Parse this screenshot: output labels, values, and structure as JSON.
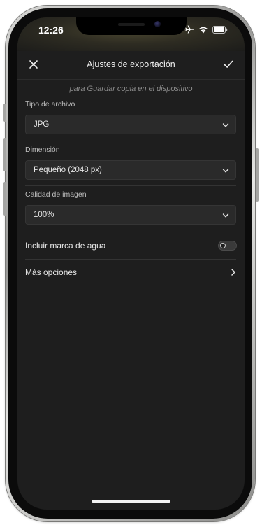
{
  "status_bar": {
    "time": "12:26",
    "icons": [
      "airplane-icon",
      "wifi-icon",
      "battery-icon"
    ]
  },
  "header": {
    "title": "Ajustes de exportación",
    "close_icon": "close-icon",
    "confirm_icon": "checkmark-icon"
  },
  "subtitle": "para Guardar copia en el dispositivo",
  "fields": [
    {
      "label": "Tipo de archivo",
      "value": "JPG"
    },
    {
      "label": "Dimensión",
      "value": "Pequeño (2048 px)"
    },
    {
      "label": "Calidad de imagen",
      "value": "100%"
    }
  ],
  "watermark": {
    "label": "Incluir marca de agua",
    "enabled": false
  },
  "more_options": {
    "label": "Más opciones"
  },
  "colors": {
    "background": "#1e1e1e",
    "field_background": "#2a2a2a",
    "text": "#e6e6e6",
    "muted_text": "#8c8c8c"
  }
}
